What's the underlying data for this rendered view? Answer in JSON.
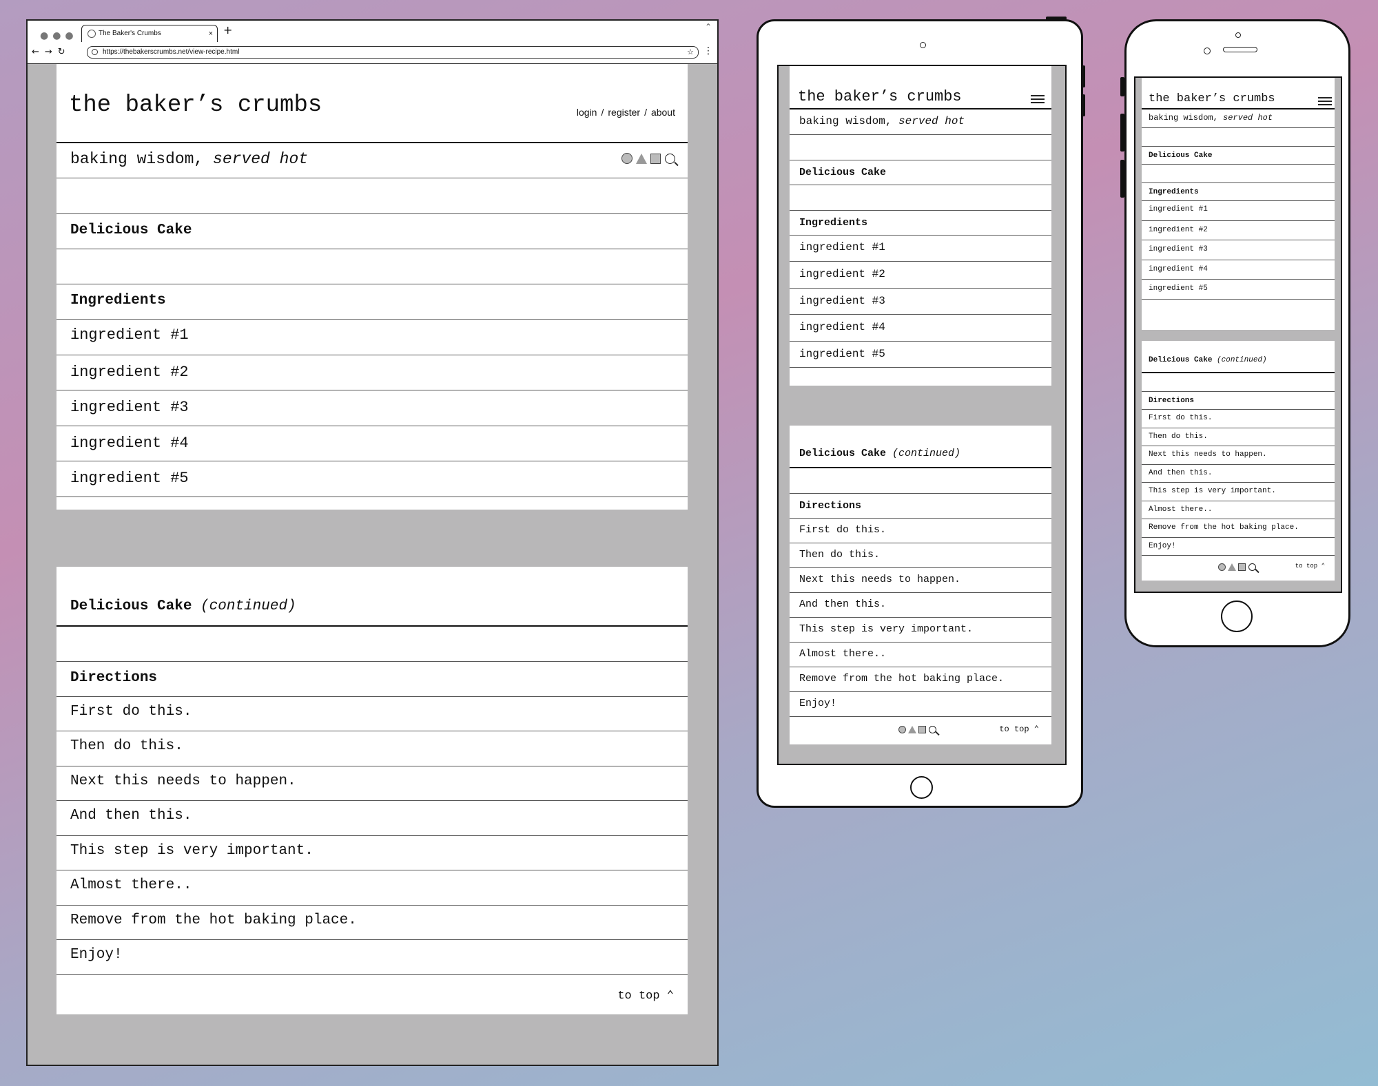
{
  "browser": {
    "tab_title": "The Baker's Crumbs",
    "tab_close": "×",
    "new_tab": "+",
    "url": "https://thebakerscrumbs.net/view-recipe.html",
    "window_dots": "●●●",
    "nav_buttons": "←→↻",
    "star": "☆",
    "menu": "⋮",
    "window_arrow": "⌃"
  },
  "site": {
    "title": "the baker’s crumbs",
    "tagline_plain": "baking wisdom,",
    "tagline_italic": "served hot",
    "nav": {
      "login": "login",
      "register": "register",
      "about": "about",
      "separator": "/"
    },
    "icons": [
      "circle-icon",
      "triangle-icon",
      "square-icon",
      "search-icon"
    ]
  },
  "recipe": {
    "name": "Delicious Cake",
    "continued": "(continued)",
    "ingredients_heading": "Ingredients",
    "ingredients": [
      "ingredient #1",
      "ingredient #2",
      "ingredient #3",
      "ingredient #4",
      "ingredient #5"
    ],
    "directions_heading": "Directions",
    "directions": [
      "First do this.",
      "Then do this.",
      "Next this needs to happen.",
      "And then this.",
      "This step is very important.",
      "Almost there..",
      "Remove from the hot baking place.",
      "Enjoy!"
    ],
    "to_top": "to top ⌃"
  }
}
